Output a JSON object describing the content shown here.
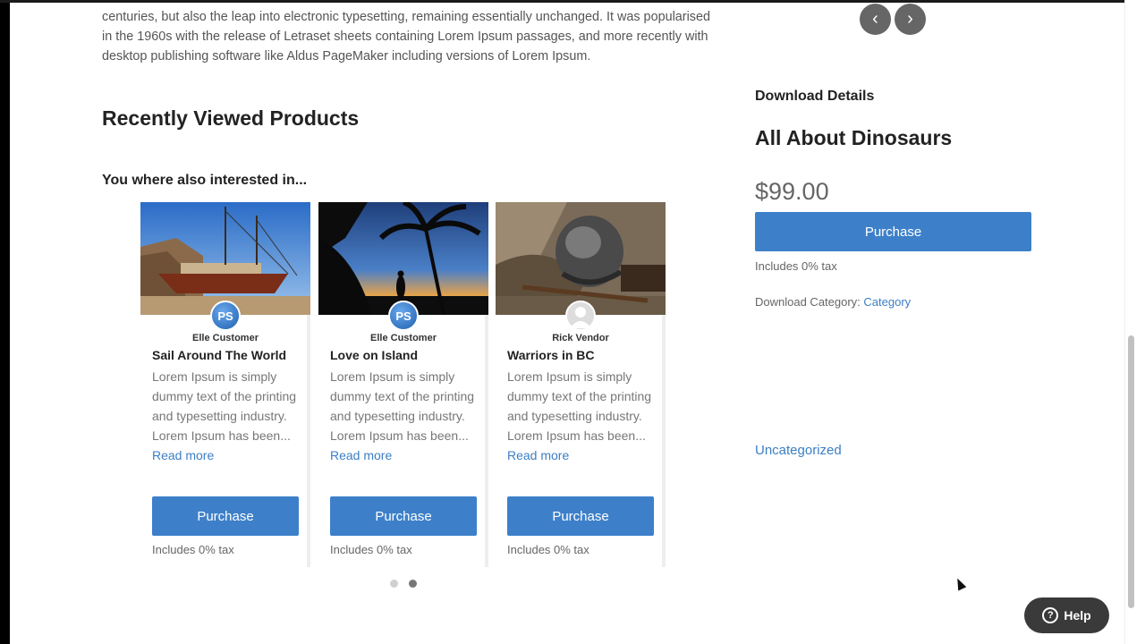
{
  "intro_text": "centuries, but also the leap into electronic typesetting, remaining essentially unchanged. It was popularised in the 1960s with the release of Letraset sheets containing Lorem Ipsum passages, and more recently with desktop publishing software like Aldus PageMaker including versions of Lorem Ipsum.",
  "recent_heading": "Recently Viewed Products",
  "also_heading": "You where also interested in...",
  "cards": [
    {
      "author": "Elle Customer",
      "title": "Sail Around The World",
      "desc": "Lorem Ipsum is simply dummy text of the printing and typesetting industry. Lorem Ipsum has been...",
      "read_more": "Read more",
      "button": "Purchase",
      "tax": "Includes 0% tax",
      "avatar": "PS"
    },
    {
      "author": "Elle Customer",
      "title": "Love on Island",
      "desc": "Lorem Ipsum is simply dummy text of the printing and typesetting industry. Lorem Ipsum has been...",
      "read_more": "Read more",
      "button": "Purchase",
      "tax": "Includes 0% tax",
      "avatar": "PS"
    },
    {
      "author": "Rick Vendor",
      "title": "Warriors in BC",
      "desc": "Lorem Ipsum is simply dummy text of the printing and typesetting industry. Lorem Ipsum has been...",
      "read_more": "Read more",
      "button": "Purchase",
      "tax": "Includes 0% tax",
      "avatar": ""
    }
  ],
  "nav": {
    "prev_icon": "chevron-left-icon",
    "next_icon": "chevron-right-icon"
  },
  "download": {
    "heading": "Download Details",
    "title": "All About Dinosaurs",
    "price": "$99.00",
    "button": "Purchase",
    "tax": "Includes 0% tax",
    "category_label": "Download Category:",
    "category_link": "Category",
    "uncategorized": "Uncategorized"
  },
  "help": {
    "label": "Help",
    "icon": "question-icon"
  },
  "colors": {
    "accent": "#3d80c9",
    "link": "#3b7fc4"
  }
}
